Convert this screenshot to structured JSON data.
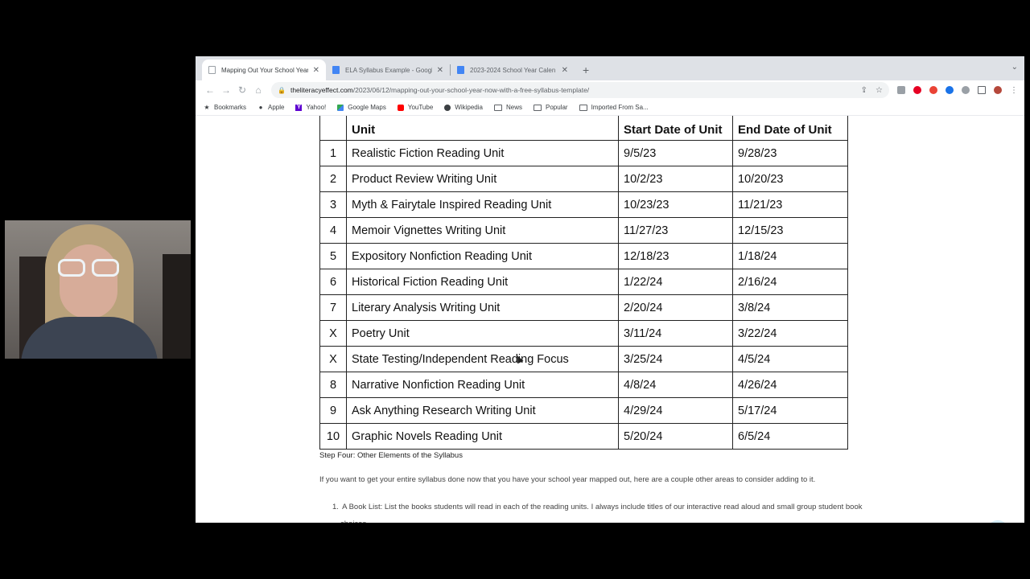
{
  "tabs": [
    {
      "title": "Mapping Out Your School Year",
      "favicon": "page-icon",
      "active": true
    },
    {
      "title": "ELA Syllabus Example - Google",
      "favicon": "docs-icon",
      "active": false
    },
    {
      "title": "2023-2024 School Year Calen",
      "favicon": "docs-icon",
      "active": false
    }
  ],
  "toolbar": {
    "url_domain": "theliteracyeffect.com",
    "url_path": "/2023/06/12/mapping-out-your-school-year-now-with-a-free-syllabus-template/"
  },
  "bookmarks": [
    {
      "label": "Bookmarks",
      "icon": "star-icon"
    },
    {
      "label": "Apple",
      "icon": "apple-icon"
    },
    {
      "label": "Yahoo!",
      "icon": "yahoo-icon"
    },
    {
      "label": "Google Maps",
      "icon": "maps-icon"
    },
    {
      "label": "YouTube",
      "icon": "youtube-icon"
    },
    {
      "label": "Wikipedia",
      "icon": "wikipedia-icon"
    },
    {
      "label": "News",
      "icon": "folder-icon"
    },
    {
      "label": "Popular",
      "icon": "folder-icon"
    },
    {
      "label": "Imported From Sa...",
      "icon": "folder-icon"
    }
  ],
  "table": {
    "headers": [
      "",
      "Unit",
      "Start Date of Unit",
      "End Date of Unit"
    ],
    "rows": [
      [
        "1",
        "Realistic Fiction Reading Unit",
        "9/5/23",
        "9/28/23"
      ],
      [
        "2",
        "Product Review Writing Unit",
        "10/2/23",
        "10/20/23"
      ],
      [
        "3",
        "Myth & Fairytale Inspired Reading Unit",
        "10/23/23",
        "11/21/23"
      ],
      [
        "4",
        "Memoir Vignettes Writing Unit",
        "11/27/23",
        "12/15/23"
      ],
      [
        "5",
        "Expository Nonfiction Reading Unit",
        "12/18/23",
        "1/18/24"
      ],
      [
        "6",
        "Historical Fiction Reading Unit",
        "1/22/24",
        "2/16/24"
      ],
      [
        "7",
        "Literary Analysis Writing Unit",
        "2/20/24",
        "3/8/24"
      ],
      [
        "X",
        "Poetry Unit",
        "3/11/24",
        "3/22/24"
      ],
      [
        "X",
        "State Testing/Independent Reading Focus",
        "3/25/24",
        "4/5/24"
      ],
      [
        "8",
        "Narrative Nonfiction Reading Unit",
        "4/8/24",
        "4/26/24"
      ],
      [
        "9",
        "Ask Anything Research Writing Unit",
        "4/29/24",
        "5/17/24"
      ],
      [
        "10",
        "Graphic Novels Reading Unit",
        "5/20/24",
        "6/5/24"
      ]
    ]
  },
  "content": {
    "step_heading": "Step Four: Other Elements of the Syllabus",
    "intro": "If you want to get your entire syllabus done now that you have your school year mapped out, here are a couple other areas to consider adding to it.",
    "list_item_1_num": "1.",
    "list_item_1_line1": "A Book List: List the books students will read in each of the reading units. I always include titles of our interactive read aloud and small group student book",
    "list_item_1_line2": "choices."
  },
  "colors": {
    "tabstrip": "#dee1e6",
    "omnibox": "#f1f3f4",
    "help_bubble": "#6cb8d9"
  }
}
